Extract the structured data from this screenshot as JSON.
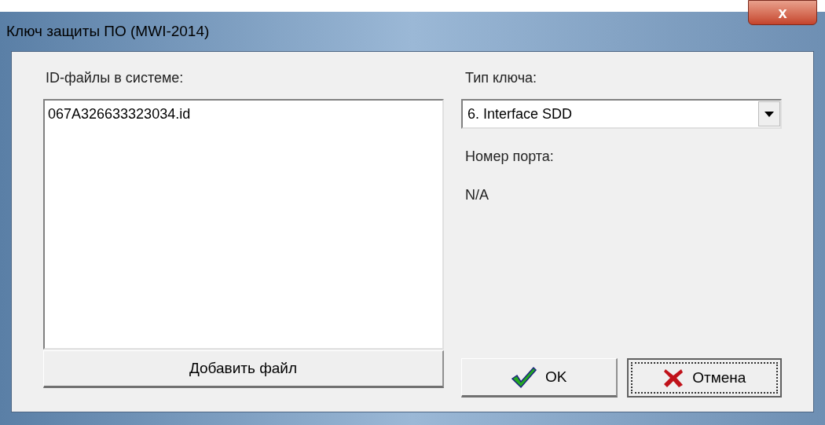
{
  "window": {
    "title": "Ключ защиты ПО (MWI-2014)",
    "close": "x"
  },
  "files": {
    "label": "ID-файлы в системе:",
    "items": [
      "067A326633323034.id"
    ],
    "add_button": "Добавить файл"
  },
  "key_type": {
    "label": "Тип ключа:",
    "value": "6. Interface SDD"
  },
  "port": {
    "label": "Номер порта:",
    "value": "N/A"
  },
  "buttons": [
    {
      "kind": "ok",
      "label": "OK",
      "focused": false
    },
    {
      "kind": "cancel",
      "label": "Отмена",
      "focused": true
    }
  ]
}
